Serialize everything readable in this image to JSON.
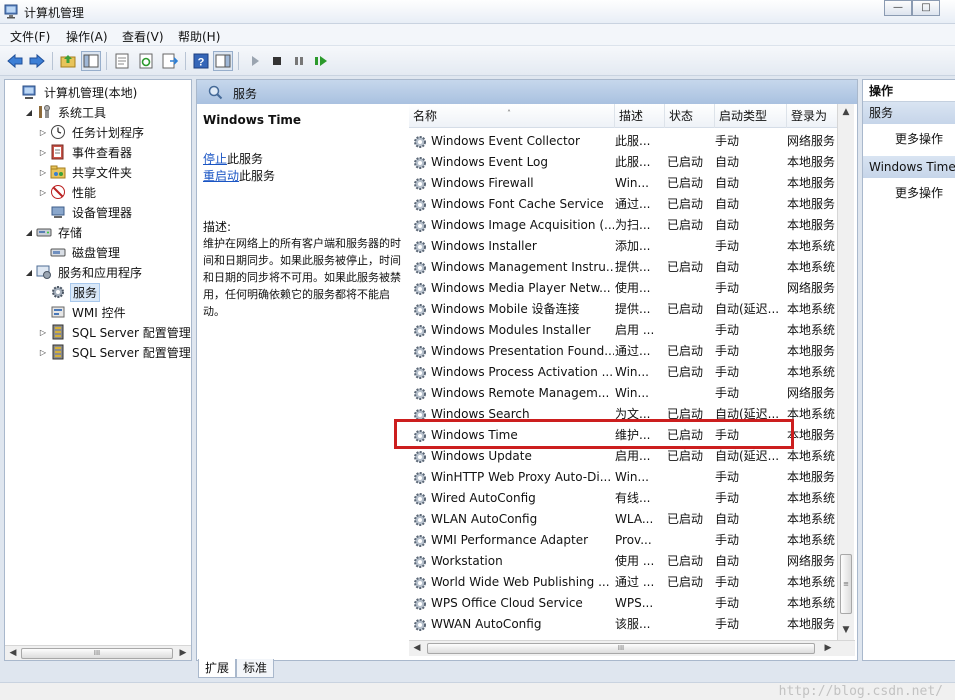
{
  "window": {
    "title": "计算机管理",
    "minimize": "—",
    "maximize": "□"
  },
  "menu": [
    "文件(F)",
    "操作(A)",
    "查看(V)",
    "帮助(H)"
  ],
  "tree": {
    "items": [
      {
        "label": "计算机管理(本地)",
        "level": 0,
        "expander": "",
        "icon": "computer-management-icon"
      },
      {
        "label": "系统工具",
        "level": 1,
        "expander": "◢",
        "icon": "system-tools-icon"
      },
      {
        "label": "任务计划程序",
        "level": 2,
        "expander": "▷",
        "icon": "task-scheduler-icon"
      },
      {
        "label": "事件查看器",
        "level": 2,
        "expander": "▷",
        "icon": "event-viewer-icon"
      },
      {
        "label": "共享文件夹",
        "level": 2,
        "expander": "▷",
        "icon": "shared-folders-icon"
      },
      {
        "label": "性能",
        "level": 2,
        "expander": "▷",
        "icon": "performance-icon"
      },
      {
        "label": "设备管理器",
        "level": 2,
        "expander": "",
        "icon": "device-manager-icon"
      },
      {
        "label": "存储",
        "level": 1,
        "expander": "◢",
        "icon": "storage-icon"
      },
      {
        "label": "磁盘管理",
        "level": 2,
        "expander": "",
        "icon": "disk-management-icon"
      },
      {
        "label": "服务和应用程序",
        "level": 1,
        "expander": "◢",
        "icon": "services-applications-icon"
      },
      {
        "label": "服务",
        "level": 2,
        "expander": "",
        "icon": "services-gear-icon",
        "selected": true
      },
      {
        "label": "WMI 控件",
        "level": 2,
        "expander": "",
        "icon": "wmi-control-icon"
      },
      {
        "label": "SQL Server 配置管理器",
        "level": 2,
        "expander": "▷",
        "icon": "sql-server-config-icon"
      },
      {
        "label": "SQL Server 配置管理器",
        "level": 2,
        "expander": "▷",
        "icon": "sql-server-config-icon"
      }
    ]
  },
  "scroll": {
    "left": "◀",
    "right": "▶",
    "up": "▲",
    "down": "▼",
    "grip": "III",
    "vgrip": "≡"
  },
  "center": {
    "header": "服务",
    "service_title": "Windows Time",
    "stop_link": "停止",
    "stop_suffix": "此服务",
    "restart_link": "重启动",
    "restart_suffix": "此服务",
    "desc_label": "描述:",
    "desc_text": "维护在网络上的所有客户端和服务器的时间和日期同步。如果此服务被停止，时间和日期的同步将不可用。如果此服务被禁用，任何明确依赖它的服务都将不能启动。"
  },
  "list": {
    "columns": [
      "名称",
      "描述",
      "状态",
      "启动类型",
      "登录为"
    ],
    "sort_indicator": "˄",
    "rows": [
      [
        "Windows Event Collector",
        "此服...",
        "",
        "手动",
        "网络服务"
      ],
      [
        "Windows Event Log",
        "此服...",
        "已启动",
        "自动",
        "本地服务"
      ],
      [
        "Windows Firewall",
        "Win...",
        "已启动",
        "自动",
        "本地服务"
      ],
      [
        "Windows Font Cache Service",
        "通过...",
        "已启动",
        "自动",
        "本地服务"
      ],
      [
        "Windows Image Acquisition (...",
        "为扫...",
        "已启动",
        "自动",
        "本地服务"
      ],
      [
        "Windows Installer",
        "添加...",
        "",
        "手动",
        "本地系统"
      ],
      [
        "Windows Management Instru...",
        "提供...",
        "已启动",
        "自动",
        "本地系统"
      ],
      [
        "Windows Media Player Netw...",
        "使用...",
        "",
        "手动",
        "网络服务"
      ],
      [
        "Windows Mobile 设备连接",
        "提供...",
        "已启动",
        "自动(延迟...",
        "本地系统"
      ],
      [
        "Windows Modules Installer",
        "启用 ...",
        "",
        "手动",
        "本地系统"
      ],
      [
        "Windows Presentation Found...",
        "通过...",
        "已启动",
        "手动",
        "本地服务"
      ],
      [
        "Windows Process Activation ...",
        "Win...",
        "已启动",
        "手动",
        "本地系统"
      ],
      [
        "Windows Remote Managem...",
        "Win...",
        "",
        "手动",
        "网络服务"
      ],
      [
        "Windows Search",
        "为文...",
        "已启动",
        "自动(延迟...",
        "本地系统"
      ],
      [
        "Windows Time",
        "维护...",
        "已启动",
        "手动",
        "本地服务"
      ],
      [
        "Windows Update",
        "启用...",
        "已启动",
        "自动(延迟...",
        "本地系统"
      ],
      [
        "WinHTTP Web Proxy Auto-Di...",
        "Win...",
        "",
        "手动",
        "本地服务"
      ],
      [
        "Wired AutoConfig",
        "有线...",
        "",
        "手动",
        "本地系统"
      ],
      [
        "WLAN AutoConfig",
        "WLA...",
        "已启动",
        "自动",
        "本地系统"
      ],
      [
        "WMI Performance Adapter",
        "Prov...",
        "",
        "手动",
        "本地系统"
      ],
      [
        "Workstation",
        "使用 ...",
        "已启动",
        "自动",
        "网络服务"
      ],
      [
        "World Wide Web Publishing ...",
        "通过 ...",
        "已启动",
        "手动",
        "本地系统"
      ],
      [
        "WPS Office Cloud Service",
        "WPS...",
        "",
        "手动",
        "本地系统"
      ],
      [
        "WWAN AutoConfig",
        "该服...",
        "",
        "手动",
        "本地服务"
      ]
    ]
  },
  "tabs": [
    "扩展",
    "标准"
  ],
  "actions": {
    "title": "操作",
    "section1": "服务",
    "more1": "更多操作",
    "section2": "Windows Time",
    "more2": "更多操作"
  },
  "watermark": "http://blog.csdn.net/",
  "colors": {
    "highlight": "#cc1e1e",
    "link": "#1a55c4",
    "header": "#a9c1e0"
  }
}
